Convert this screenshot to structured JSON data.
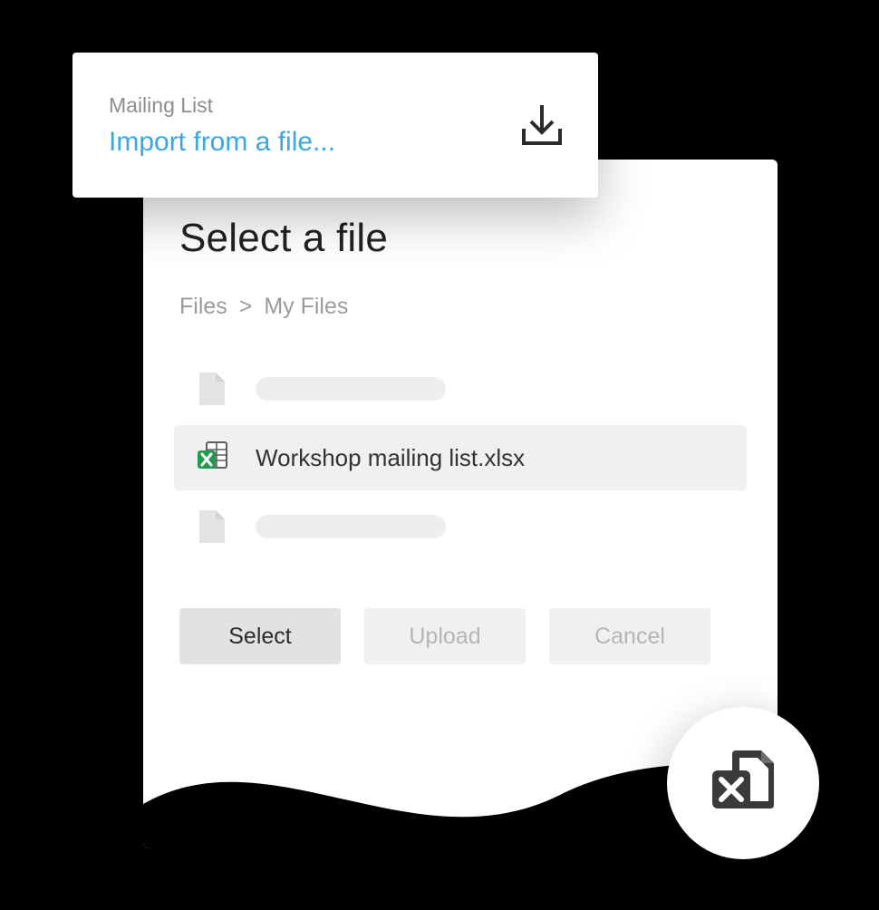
{
  "top_card": {
    "label": "Mailing List",
    "link_text": "Import from a file...",
    "icon": "download-icon"
  },
  "picker": {
    "title": "Select a file",
    "breadcrumb": {
      "root": "Files",
      "separator": ">",
      "current": "My Files"
    },
    "files": [
      {
        "name": "",
        "placeholder": true,
        "selected": false,
        "icon": "generic-file-icon"
      },
      {
        "name": "Workshop mailing list.xlsx",
        "placeholder": false,
        "selected": true,
        "icon": "excel-file-icon"
      },
      {
        "name": "",
        "placeholder": true,
        "selected": false,
        "icon": "generic-file-icon"
      }
    ],
    "buttons": {
      "select": "Select",
      "upload": "Upload",
      "cancel": "Cancel"
    }
  },
  "badge": {
    "icon": "excel-file-icon"
  }
}
